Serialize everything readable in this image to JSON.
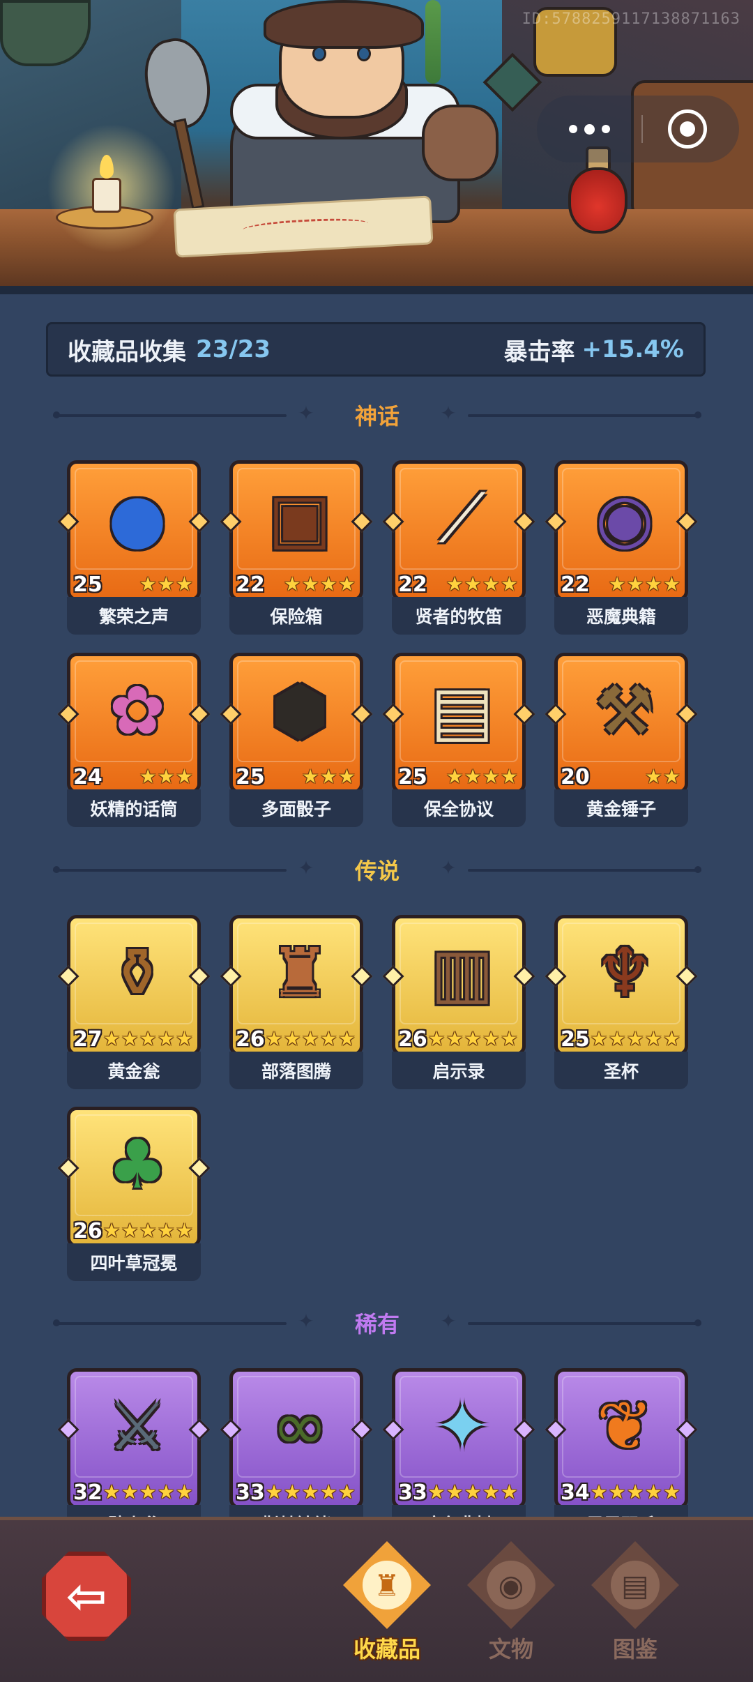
{
  "header": {
    "user_id": "ID:5788259117138871163",
    "menu_icon": "more-dots-icon",
    "close_icon": "target-circle-icon"
  },
  "stats": {
    "collection_label": "收藏品收集",
    "collection_count": "23/23",
    "crit_label": "暴击率",
    "crit_value": "+15.4%"
  },
  "sections": {
    "myth": {
      "title": "神话",
      "color": "#f2a33a",
      "items": [
        {
          "name": "繁荣之声",
          "level": "25",
          "stars": 3,
          "icon": "blue-orb-icon"
        },
        {
          "name": "保险箱",
          "level": "22",
          "stars": 4,
          "icon": "treasure-chest-icon"
        },
        {
          "name": "贤者的牧笛",
          "level": "22",
          "stars": 4,
          "icon": "flute-icon"
        },
        {
          "name": "恶魔典籍",
          "level": "22",
          "stars": 4,
          "icon": "demon-book-icon"
        },
        {
          "name": "妖精的话筒",
          "level": "24",
          "stars": 3,
          "icon": "fairy-microphone-icon"
        },
        {
          "name": "多面骰子",
          "level": "25",
          "stars": 3,
          "icon": "dice-icon"
        },
        {
          "name": "保全协议",
          "level": "25",
          "stars": 4,
          "icon": "scroll-contract-icon"
        },
        {
          "name": "黄金锤子",
          "level": "20",
          "stars": 2,
          "icon": "golden-hammer-icon"
        }
      ]
    },
    "legend": {
      "title": "传说",
      "color": "#f4c84a",
      "items": [
        {
          "name": "黄金瓮",
          "level": "27",
          "stars": 5,
          "icon": "golden-urn-icon"
        },
        {
          "name": "部落图腾",
          "level": "26",
          "stars": 5,
          "icon": "tribal-totem-icon"
        },
        {
          "name": "启示录",
          "level": "26",
          "stars": 5,
          "icon": "open-book-icon"
        },
        {
          "name": "圣杯",
          "level": "25",
          "stars": 5,
          "icon": "holy-grail-icon"
        },
        {
          "name": "四叶草冠冕",
          "level": "26",
          "stars": 5,
          "icon": "clover-crown-icon"
        }
      ]
    },
    "rare": {
      "title": "稀有",
      "color": "#c07af0",
      "items": [
        {
          "name": "劈山斧",
          "level": "32",
          "stars": 5,
          "icon": "axe-icon"
        },
        {
          "name": "荆棘镣铐",
          "level": "33",
          "stars": 5,
          "icon": "thorn-shackles-icon"
        },
        {
          "name": "凛冬悲恸",
          "level": "33",
          "stars": 5,
          "icon": "ice-sword-icon"
        },
        {
          "name": "凤凰羽毛",
          "level": "34",
          "stars": 5,
          "icon": "phoenix-feather-icon"
        }
      ]
    }
  },
  "nav": {
    "back_icon": "back-arrow-icon",
    "tabs": [
      {
        "label": "收藏品",
        "active": true,
        "icon": "collectibles-icon"
      },
      {
        "label": "文物",
        "active": false,
        "icon": "eye-relic-icon"
      },
      {
        "label": "图鉴",
        "active": false,
        "icon": "book-codex-icon"
      }
    ]
  }
}
